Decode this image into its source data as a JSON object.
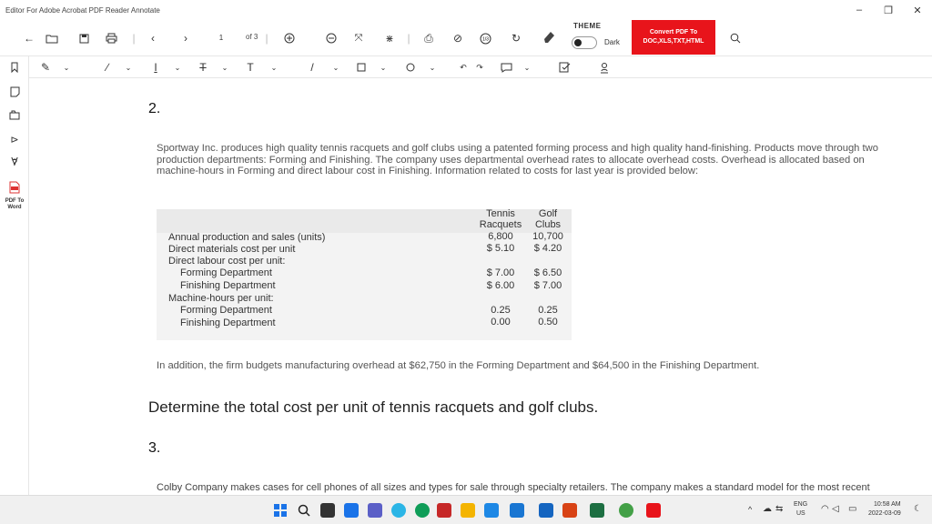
{
  "window": {
    "title": "Editor For Adobe Acrobat PDF Reader Annotate",
    "minimize": "–",
    "restore": "❐",
    "close": "✕"
  },
  "toolbar": {
    "page_value": "1",
    "page_of": "of 3",
    "theme_label": "THEME",
    "dark_label": "Dark",
    "convert_line1": "Convert PDF To",
    "convert_line2": "DOC,XLS,TXT,HTML",
    "colors": {
      "convert_bg": "#e8141b"
    }
  },
  "sidebar": {
    "pdf_to_word": "PDF To Word"
  },
  "document": {
    "q2_number": "2.",
    "q2_para": "Sportway Inc. produces high quality tennis racquets and golf clubs using a patented forming process and high quality hand-finishing. Products move through two production departments: Forming and Finishing. The company uses departmental overhead rates to allocate overhead costs. Overhead is allocated based on machine-hours in Forming and direct labour cost in Finishing. Information related to costs for last year is provided below:",
    "table": {
      "col_tennis": [
        "Tennis",
        "Racquets"
      ],
      "col_golf": [
        "Golf",
        "Clubs"
      ],
      "rows": [
        {
          "label": "Annual production and sales (units)",
          "tennis": "6,800",
          "golf": "10,700",
          "indent": false
        },
        {
          "label": "Direct materials cost per unit",
          "tennis": "$  5.10",
          "golf": "$  4.20",
          "indent": false
        },
        {
          "label": "Direct labour cost per unit:",
          "tennis": "",
          "golf": "",
          "indent": false
        },
        {
          "label": "Forming Department",
          "tennis": "$  7.00",
          "golf": "$  6.50",
          "indent": true
        },
        {
          "label": "Finishing Department",
          "tennis": "$  6.00",
          "golf": "$  7.00",
          "indent": true
        },
        {
          "label": "Machine-hours per unit:",
          "tennis": "",
          "golf": "",
          "indent": false
        },
        {
          "label": "Forming Department",
          "tennis": "0.25",
          "golf": "0.25",
          "indent": true
        },
        {
          "label": "Finishing Department",
          "tennis": "0.00",
          "golf": "0.50",
          "indent": true
        }
      ]
    },
    "addition": "In addition, the firm budgets manufacturing overhead at $62,750 in the Forming Department and $64,500 in the Finishing Department.",
    "question": "Determine the total cost per unit of tennis racquets and golf clubs.",
    "q3_number": "3.",
    "q3_para": "Colby Company makes cases for cell phones of all sizes and types for sale through specialty retailers. The company makes a standard model for the most recent"
  },
  "taskbar": {
    "lang1": "ENG",
    "lang2": "US",
    "time": "10:58 AM",
    "date": "2022-03-09"
  }
}
